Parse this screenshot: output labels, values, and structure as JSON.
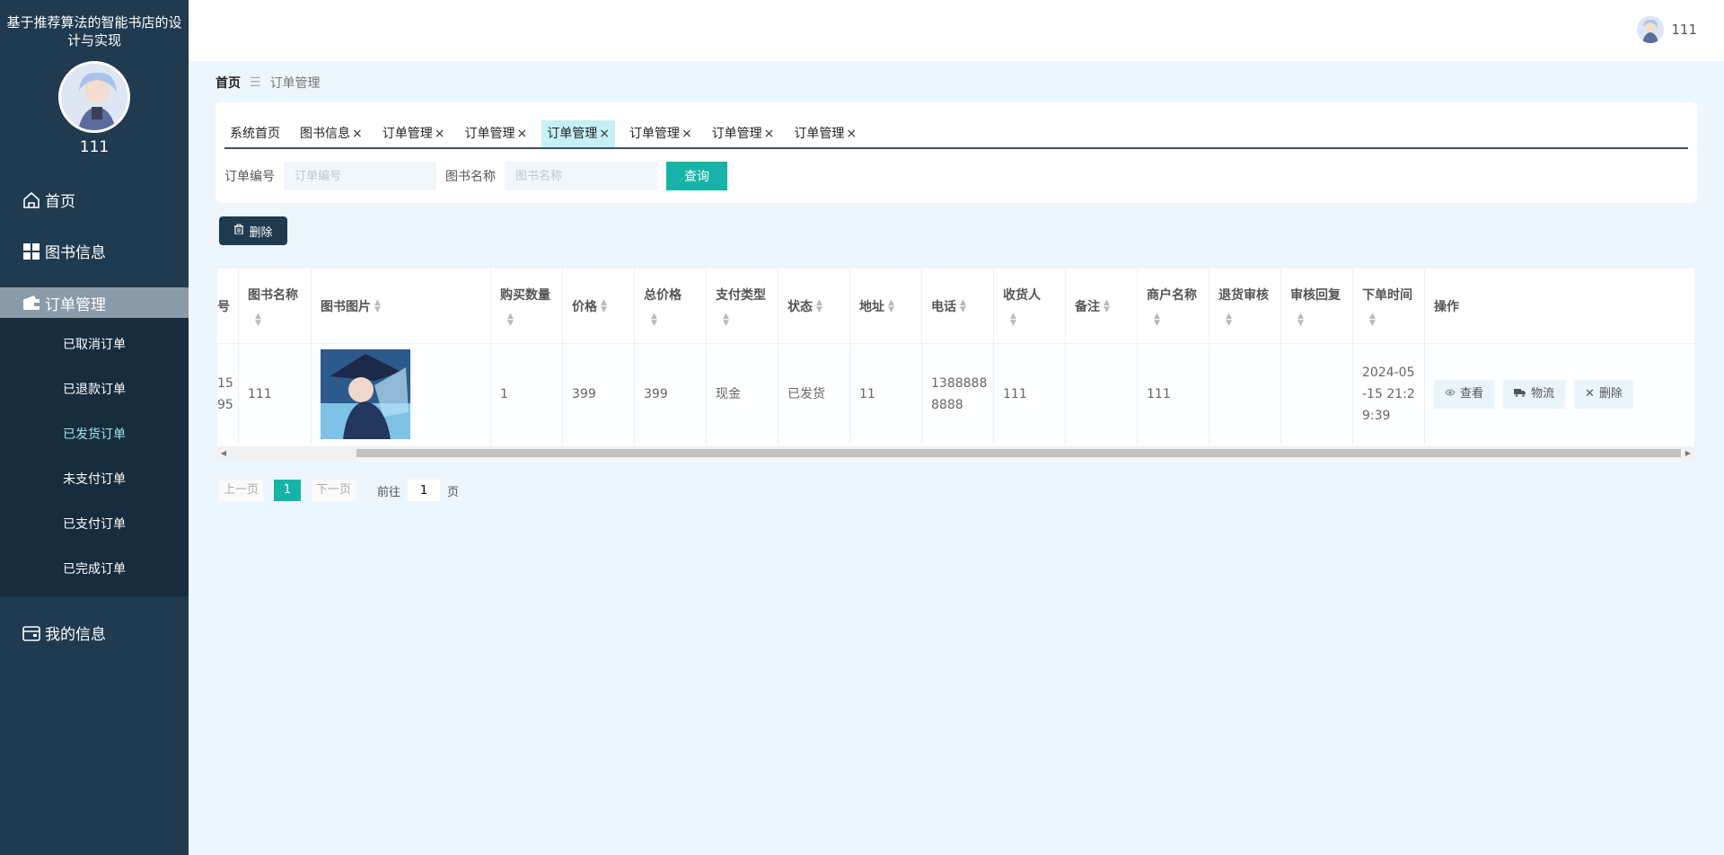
{
  "sidebar": {
    "app_title": "基于推荐算法的智能书店的设计与实现",
    "user_name": "111",
    "menu": {
      "home": "首页",
      "books": "图书信息",
      "orders": "订单管理",
      "my_info": "我的信息"
    },
    "submenu": [
      "已取消订单",
      "已退款订单",
      "已发货订单",
      "未支付订单",
      "已支付订单",
      "已完成订单"
    ]
  },
  "header": {
    "user_name": "111"
  },
  "breadcrumb": {
    "home": "首页",
    "current": "订单管理"
  },
  "tabs": [
    {
      "label": "系统首页",
      "closable": false
    },
    {
      "label": "图书信息",
      "closable": true
    },
    {
      "label": "订单管理",
      "closable": true
    },
    {
      "label": "订单管理",
      "closable": true
    },
    {
      "label": "订单管理",
      "closable": true
    },
    {
      "label": "订单管理",
      "closable": true
    },
    {
      "label": "订单管理",
      "closable": true
    },
    {
      "label": "订单管理",
      "closable": true
    }
  ],
  "search": {
    "order_no_label": "订单编号",
    "order_no_placeholder": "订单编号",
    "book_name_label": "图书名称",
    "book_name_placeholder": "图书名称",
    "query_label": "查询"
  },
  "toolbar": {
    "delete_label": "删除"
  },
  "table": {
    "headers": {
      "order_no": "号",
      "book_name": "图书名称",
      "book_image": "图书图片",
      "quantity": "购买数量",
      "price": "价格",
      "total": "总价格",
      "pay_type": "支付类型",
      "status": "状态",
      "address": "地址",
      "phone": "电话",
      "receiver": "收货人",
      "remark": "备注",
      "merchant": "商户名称",
      "refund_review": "退货审核",
      "review_reply": "审核回复",
      "order_time": "下单时间",
      "actions": "操作"
    },
    "row": {
      "order_no": "15\n95",
      "book_name": "111",
      "quantity": "1",
      "price": "399",
      "total": "399",
      "pay_type": "现金",
      "status": "已发货",
      "address": "11",
      "phone": "13888888888",
      "receiver": "111",
      "remark": "",
      "merchant": "111",
      "refund_review": "",
      "review_reply": "",
      "order_time": "2024-05-15 21:29:39",
      "view_label": "查看",
      "logistics_label": "物流",
      "delete_label": "删除"
    }
  },
  "pager": {
    "prev": "上一页",
    "current": "1",
    "next": "下一页",
    "goto": "前往",
    "goto_value": "1",
    "unit": "页"
  },
  "colors": {
    "sidebar_bg": "#203a4f",
    "accent": "#17b3a8",
    "active_tab": "#c4f0f6",
    "page_bg": "#eef6fd"
  }
}
